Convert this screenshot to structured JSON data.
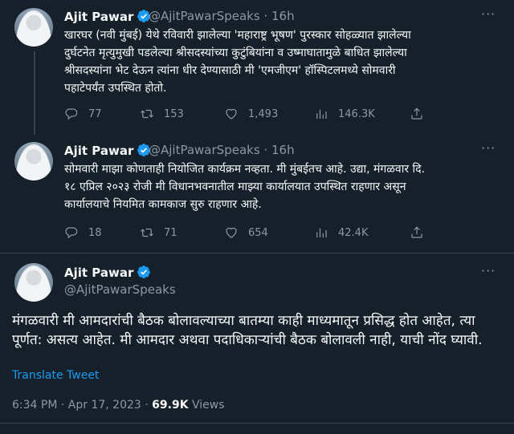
{
  "tweets": [
    {
      "name": "Ajit Pawar",
      "handle": "@AjitPawarSpeaks",
      "separator": "·",
      "time": "16h",
      "text": "खारघर (नवी मुंबई) येथे रविवारी झालेल्या 'महाराष्ट्र भूषण' पुरस्कार सोहळ्यात झालेल्या\nदुर्घटनेत मृत्युमुखी पडलेल्या श्रीसदस्यांच्या कुटुंबियांना व उष्माघातामुळे बाधित झालेल्या\nश्रीसदस्यांना भेट देऊन त्यांना धीर देण्यासाठी मी 'एमजीएम' हॉस्पिटलमध्ये सोमवारी\nपहाटेपर्यंत उपस्थित होतो.",
      "replies": "77",
      "retweets": "153",
      "likes": "1,493",
      "views": "146.3K"
    },
    {
      "name": "Ajit Pawar",
      "handle": "@AjitPawarSpeaks",
      "separator": "·",
      "time": "16h",
      "text": "सोमवारी माझा कोणताही नियोजित कार्यक्रम नव्हता. मी मुंबईतच आहे. उद्या, मंगळवार दि.\n१८ एप्रिल २०२३ रोजी मी विधानभवनातील माझ्या कार्यालयात उपस्थित राहणार असून\nकार्यालयाचे नियमित कामकाज सुरु राहणार आहे.",
      "replies": "18",
      "retweets": "71",
      "likes": "654",
      "views": "42.4K"
    }
  ],
  "main": {
    "name": "Ajit Pawar",
    "handle": "@AjitPawarSpeaks",
    "text": "मंगळवारी मी आमदारांची बैठक बोलावल्याच्या बातम्या काही माध्यमातून प्रसिद्ध होत आहेत, त्या पूर्णत: असत्य आहेत. मी आमदार अथवा पदाधिकाऱ्यांची बैठक बोलावली नाही, याची नोंद घ्यावी.",
    "translate_label": "Translate Tweet",
    "time": "6:34 PM",
    "separator": "·",
    "date": "Apr 17, 2023",
    "views_count": "69.9K",
    "views_label": "Views"
  },
  "more_glyph": "···",
  "colors": {
    "background": "#15202b",
    "accent": "#1d9bf0",
    "muted": "#8b98a5",
    "text": "#f7f9f9",
    "border": "#38444d"
  },
  "icons": [
    "verified-badge-icon",
    "reply-icon",
    "retweet-icon",
    "like-icon",
    "views-icon",
    "share-icon",
    "more-icon"
  ]
}
